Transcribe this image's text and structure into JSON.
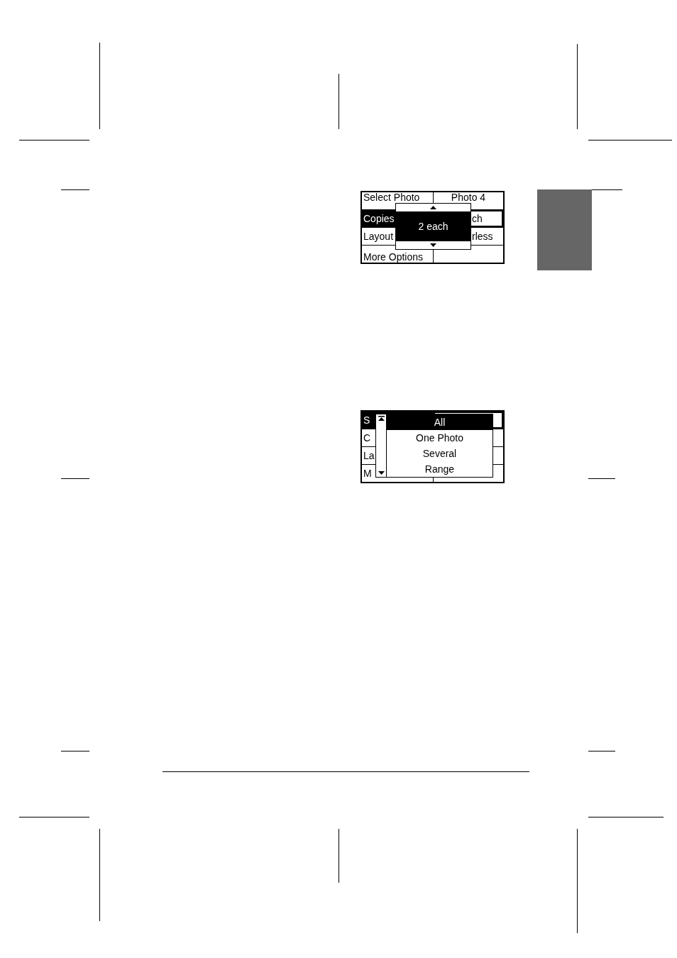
{
  "screens": [
    {
      "rows": [
        {
          "label": "Select Photo",
          "value": "Photo 4",
          "selected": false
        },
        {
          "label": "Copies",
          "value": "ch",
          "selected": true
        },
        {
          "label": "Layout",
          "value": "rless",
          "selected": false
        },
        {
          "label": "More Options",
          "selected": false
        }
      ],
      "popup": {
        "kind": "spinner",
        "items": [
          {
            "label": "2 each",
            "selected": true
          }
        ]
      }
    },
    {
      "rows": [
        {
          "label": "S",
          "selected": true
        },
        {
          "label": "C",
          "selected": false
        },
        {
          "label": "La",
          "selected": false
        },
        {
          "label": "M",
          "selected": false
        }
      ],
      "popup": {
        "kind": "list",
        "items": [
          {
            "label": "All",
            "selected": true
          },
          {
            "label": "One Photo",
            "selected": false
          },
          {
            "label": "Several",
            "selected": false
          },
          {
            "label": "Range",
            "selected": false
          }
        ]
      }
    }
  ]
}
